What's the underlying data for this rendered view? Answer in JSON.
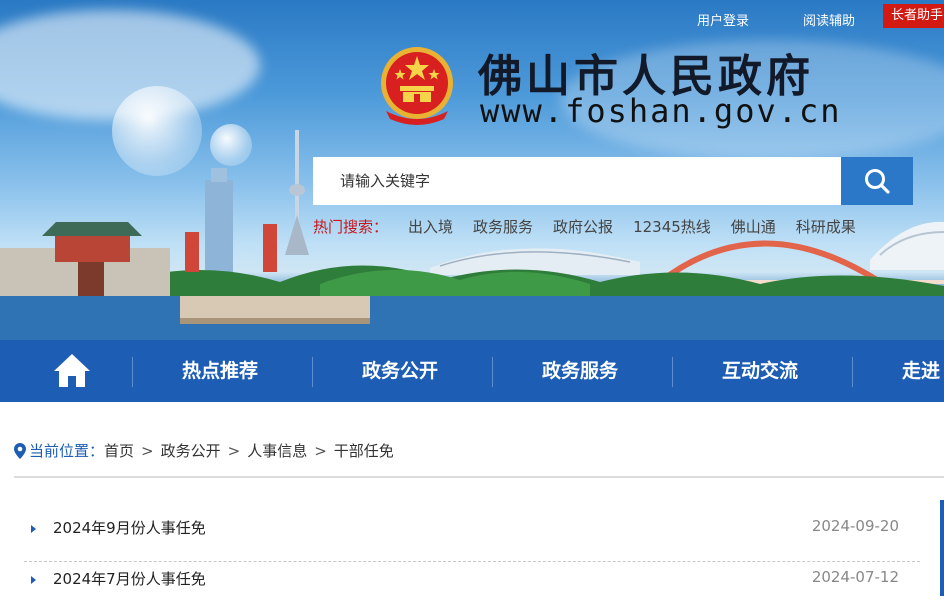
{
  "topbar": {
    "login": "用户登录",
    "reading_aid": "阅读辅助",
    "elder_mode": "长者助手"
  },
  "header": {
    "site_title": "佛山市人民政府",
    "site_url": "www.foshan.gov.cn"
  },
  "search": {
    "placeholder": "请输入关键字",
    "hot_label": "热门搜索：",
    "hot_keywords": [
      "出入境",
      "政务服务",
      "政府公报",
      "12345热线",
      "佛山通",
      "科研成果"
    ]
  },
  "nav": {
    "items": [
      "热点推荐",
      "政务公开",
      "政务服务",
      "互动交流",
      "走进"
    ]
  },
  "breadcrumb": {
    "label": "当前位置：",
    "items": [
      "首页",
      "政务公开",
      "人事信息",
      "干部任免"
    ]
  },
  "list": {
    "items": [
      {
        "title": "2024年9月份人事任免",
        "date": "2024-09-20"
      },
      {
        "title": "2024年7月份人事任免",
        "date": "2024-07-12"
      }
    ]
  },
  "colors": {
    "nav_blue": "#1d5eb4",
    "search_button": "#2b78c9",
    "elder_red": "#d31a12",
    "hot_label_red": "#c8161d"
  },
  "icons": {
    "home": "home-icon",
    "search": "search-icon",
    "location": "location-pin-icon",
    "emblem": "national-emblem-icon",
    "list_bullet": "triangle-bullet-icon"
  }
}
